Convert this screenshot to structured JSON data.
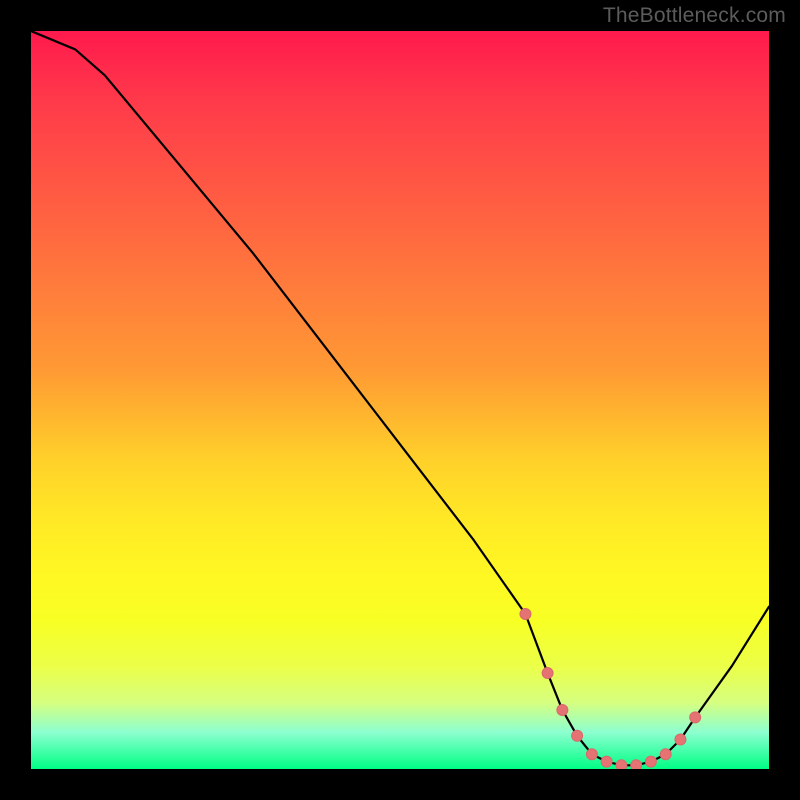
{
  "watermark": {
    "text": "TheBottleneck.com"
  },
  "colors": {
    "page_bg": "#000000",
    "curve_stroke": "#000000",
    "marker_fill": "#e57373",
    "marker_stroke": "#d86a6a"
  },
  "chart_data": {
    "type": "line",
    "title": "",
    "xlabel": "",
    "ylabel": "",
    "xlim": [
      0,
      1
    ],
    "ylim": [
      0,
      100
    ],
    "grid": false,
    "legend": null,
    "gradient_meaning": "background vertical gradient: red (high bottleneck) at top → green (no bottleneck) at bottom",
    "series": [
      {
        "name": "bottleneck-curve",
        "type": "line",
        "x": [
          0.0,
          0.06,
          0.1,
          0.2,
          0.3,
          0.4,
          0.5,
          0.6,
          0.67,
          0.7,
          0.72,
          0.74,
          0.76,
          0.78,
          0.8,
          0.82,
          0.84,
          0.86,
          0.88,
          0.9,
          0.95,
          1.0
        ],
        "values": [
          100,
          97.5,
          94,
          82,
          70,
          57,
          44,
          31,
          21,
          13,
          8,
          4.5,
          2,
          1,
          0.5,
          0.5,
          1,
          2,
          4,
          7,
          14,
          22
        ]
      },
      {
        "name": "flat-region-markers",
        "type": "scatter",
        "x": [
          0.67,
          0.7,
          0.72,
          0.74,
          0.76,
          0.78,
          0.8,
          0.82,
          0.84,
          0.86,
          0.88,
          0.9
        ],
        "values": [
          21,
          13,
          8,
          4.5,
          2,
          1,
          0.5,
          0.5,
          1,
          2,
          4,
          7
        ]
      }
    ]
  }
}
